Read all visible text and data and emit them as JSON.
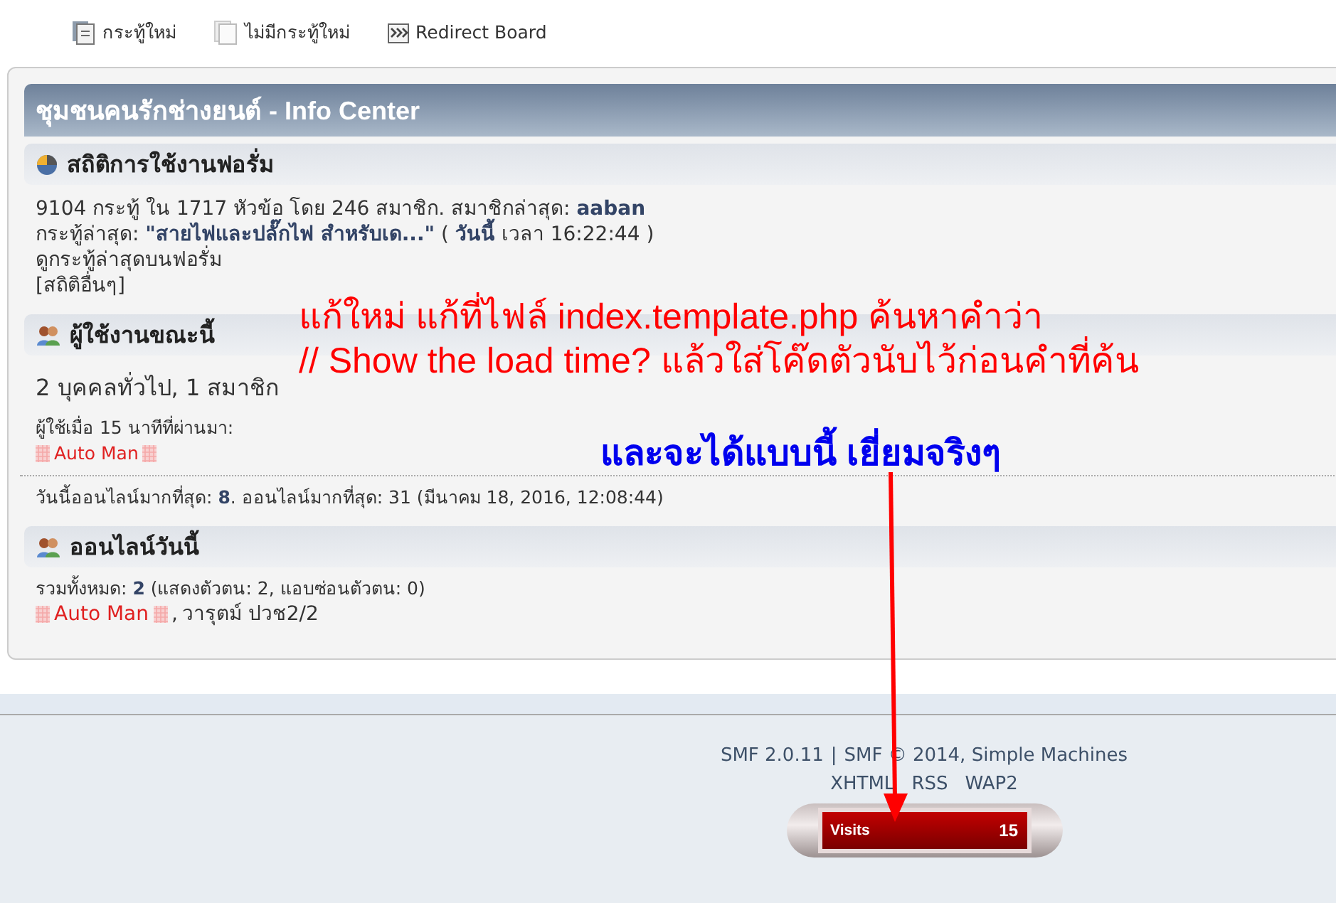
{
  "legend": [
    {
      "kind": "new",
      "label": "กระทู้ใหม่"
    },
    {
      "kind": "none",
      "label": "ไม่มีกระทู้ใหม่"
    },
    {
      "kind": "redirect",
      "label": "Redirect Board"
    }
  ],
  "info_center": {
    "title": "ชุมชนคนรักช่างยนต์ - Info Center",
    "stats": {
      "title": "สถิติการใช้งานฟอรั่ม",
      "lines": [
        "9104 กระทู้ ใน 1717 หัวข้อ โดย 246 สมาชิก. สมาชิกล่าสุด: **aaban**",
        "กระทู้ล่าสุด: **\"สายไฟและปลั๊กไฟ สำหรับเด...\"** ( **วันนี้** เวลา 16:22:44 )"
      ],
      "links": [
        "ดูกระทู้ล่าสุดบนฟอรั่ม",
        "[สถิติอื่นๆ]"
      ]
    },
    "users_online": {
      "title": "ผู้ใช้งานขณะนี้",
      "summary": "2 บุคคลทั่วไป, 1 สมาชิก",
      "recent_label": "ผู้ใช้เมื่อ 15 นาทีที่ผ่านมา:",
      "members": [
        {
          "name": "Auto Man",
          "decorated": true
        }
      ],
      "record": "วันนี้ออนไลน์มากที่สุด: **8**. ออนไลน์มากที่สุด: 31 (มีนาคม 18, 2016, 12:08:44)"
    },
    "online_today": {
      "title": "ออนไลน์วันนี้",
      "summary": "รวมทั้งหมด: **2** (แสดงตัวตน: 2, แอบซ่อนตัวตน: 0)",
      "separator": ",",
      "members": [
        {
          "name": "Auto Man",
          "decorated": true
        },
        {
          "name": "วารุตม์ ปวช2/2",
          "decorated": false
        }
      ]
    }
  },
  "footer": {
    "version": "SMF 2.0.11",
    "divider": "|",
    "copyright": "SMF © 2014, Simple Machines",
    "links": [
      "XHTML",
      "RSS",
      "WAP2"
    ],
    "counter": {
      "label": "Visits",
      "value": "15"
    }
  },
  "annotations": [
    {
      "kind": "instruction",
      "color": "#ff0000",
      "lines": [
        "แก้ใหม่ แก้ที่ไฟล์ index.template.php ค้นหาคำว่า",
        "// Show the load time?  แล้วใส่โค๊ดตัวนับไว้ก่อนคำที่ค้น"
      ]
    },
    {
      "kind": "result",
      "color": "#0000ee",
      "lines": [
        "และจะได้แบบนี้ เยี่ยมจริงๆ"
      ]
    }
  ]
}
